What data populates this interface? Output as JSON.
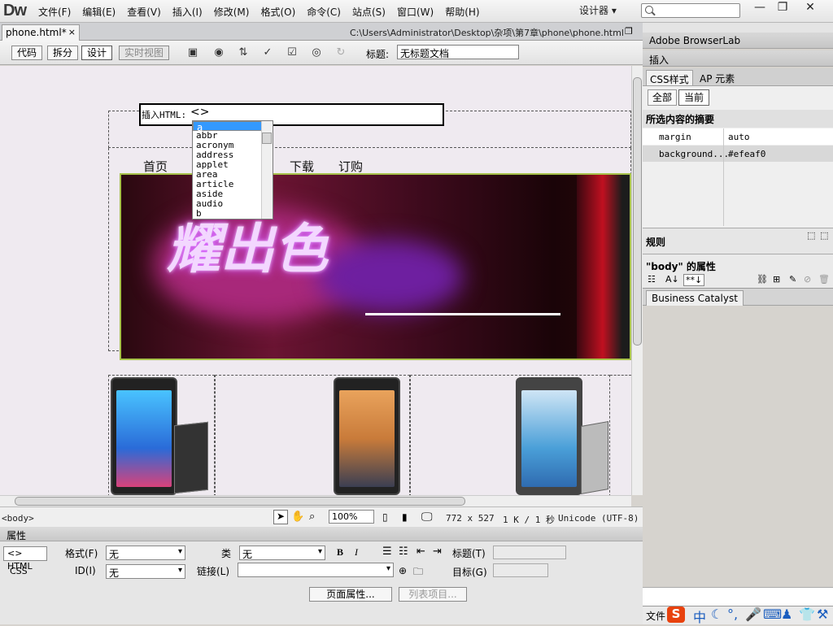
{
  "app": {
    "logo": "Dw",
    "designer": "设计器 ▾"
  },
  "menu": [
    "文件(F)",
    "编辑(E)",
    "查看(V)",
    "插入(I)",
    "修改(M)",
    "格式(O)",
    "命令(C)",
    "站点(S)",
    "窗口(W)",
    "帮助(H)"
  ],
  "window_buttons": {
    "minimize": "—",
    "restore": "❐",
    "close": "✕"
  },
  "doc_tab": {
    "name": "phone.html*",
    "close": "×",
    "path": "C:\\Users\\Administrator\\Desktop\\杂项\\第7章\\phone\\phone.html"
  },
  "toolbar": {
    "code": "代码",
    "split": "拆分",
    "design": "设计",
    "live": "实时视图",
    "title_label": "标题:",
    "title_value": "无标题文档"
  },
  "canvas": {
    "insert_html": {
      "label": "插入HTML:",
      "tag": "<>"
    },
    "autocomplete": [
      "a",
      "abbr",
      "acronym",
      "address",
      "applet",
      "area",
      "article",
      "aside",
      "audio",
      "b"
    ],
    "nav": [
      "首页",
      "下载",
      "订购"
    ],
    "banner_text": "耀出色"
  },
  "status": {
    "tag": "<body>",
    "zoom": "100%",
    "size": "772 x 527",
    "weight": "1 K / 1 秒",
    "encoding": "Unicode (UTF-8)"
  },
  "props": {
    "title": "属性",
    "html_btn": "<> HTML",
    "css_btn": "CSS",
    "format_label": "格式(F)",
    "format_value": "无",
    "class_label": "类",
    "class_value": "无",
    "id_label": "ID(I)",
    "id_value": "无",
    "link_label": "链接(L)",
    "link_value": "",
    "title_label": "标题(T)",
    "target_label": "目标(G)",
    "bold": "B",
    "italic": "I",
    "page_props": "页面属性...",
    "list_items": "列表项目..."
  },
  "right": {
    "browserlab": "Adobe BrowserLab",
    "insert": "插入",
    "css_tab": "CSS样式",
    "ap_tab": "AP 元素",
    "all": "全部",
    "current": "当前",
    "summary": "所选内容的摘要",
    "css_props": [
      {
        "name": "margin",
        "value": "auto"
      },
      {
        "name": "background...",
        "value": "#efeaf0"
      }
    ],
    "rules": "规则",
    "body_props": "\"body\" 的属性",
    "bc": "Business Catalyst",
    "files": "文件"
  },
  "colors": {
    "canvas_bg": "#efeaf0",
    "selection": "#3399ff",
    "banner_border": "#a7c24a"
  }
}
